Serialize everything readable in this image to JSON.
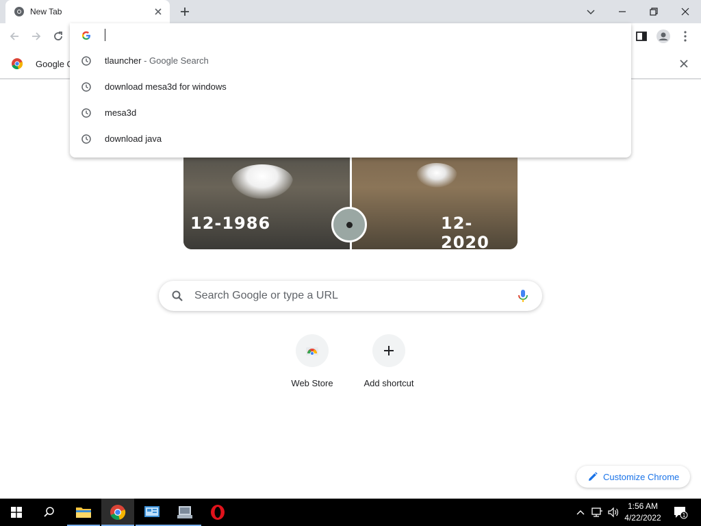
{
  "browser": {
    "tab": {
      "title": "New Tab"
    },
    "infobar": {
      "text": "Google C"
    }
  },
  "omnibox": {
    "suggestions": [
      {
        "text": "tlauncher",
        "suffix": " - Google Search"
      },
      {
        "text": "download mesa3d for windows",
        "suffix": ""
      },
      {
        "text": "mesa3d",
        "suffix": ""
      },
      {
        "text": "download java",
        "suffix": ""
      }
    ]
  },
  "doodle": {
    "left_date": "12-1986",
    "right_date": "12-2020"
  },
  "search": {
    "placeholder": "Search Google or type a URL"
  },
  "shortcuts": [
    {
      "label": "Web Store",
      "icon": "chrome-web-store-icon"
    },
    {
      "label": "Add shortcut",
      "icon": "plus-icon"
    }
  ],
  "customize": {
    "label": "Customize Chrome"
  },
  "taskbar": {
    "clock": {
      "time": "1:56 AM",
      "date": "4/22/2022"
    },
    "notification_count": "1"
  },
  "colors": {
    "accent": "#1a73e8",
    "tabstrip": "#dee1e6",
    "taskbar": "#000000"
  }
}
